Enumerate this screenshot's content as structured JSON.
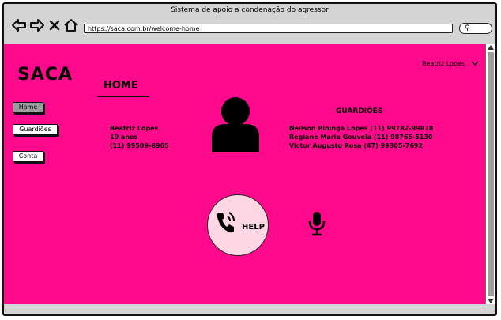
{
  "browser": {
    "window_title": "Sistema de apoio a condenação do agressor",
    "url": "https://saca.com.br/welcome-home",
    "search_icon": "search-icon"
  },
  "app": {
    "logo": "SACA",
    "user_name": "Beatriz Lopes",
    "page_heading": "HOME"
  },
  "sidebar": {
    "items": [
      {
        "label": "Home",
        "active": true
      },
      {
        "label": "Guardiões",
        "active": false
      },
      {
        "label": "Conta",
        "active": false
      }
    ]
  },
  "profile": {
    "name": "Beatriz Lopes",
    "age": "19 anos",
    "phone": "(11) 99509-8965"
  },
  "guardians": {
    "title": "GUARDIÕES",
    "list": [
      "Neilson Pininga Lopes (11) 99782-99878",
      "Regiane Maria Gouveia (11) 98765-5130",
      "Victor Augusto Rosa (47) 99305-7692"
    ]
  },
  "actions": {
    "help_label": "HELP"
  },
  "colors": {
    "content_bg": "#ff0a8c",
    "help_bg": "#ffd6e4"
  }
}
